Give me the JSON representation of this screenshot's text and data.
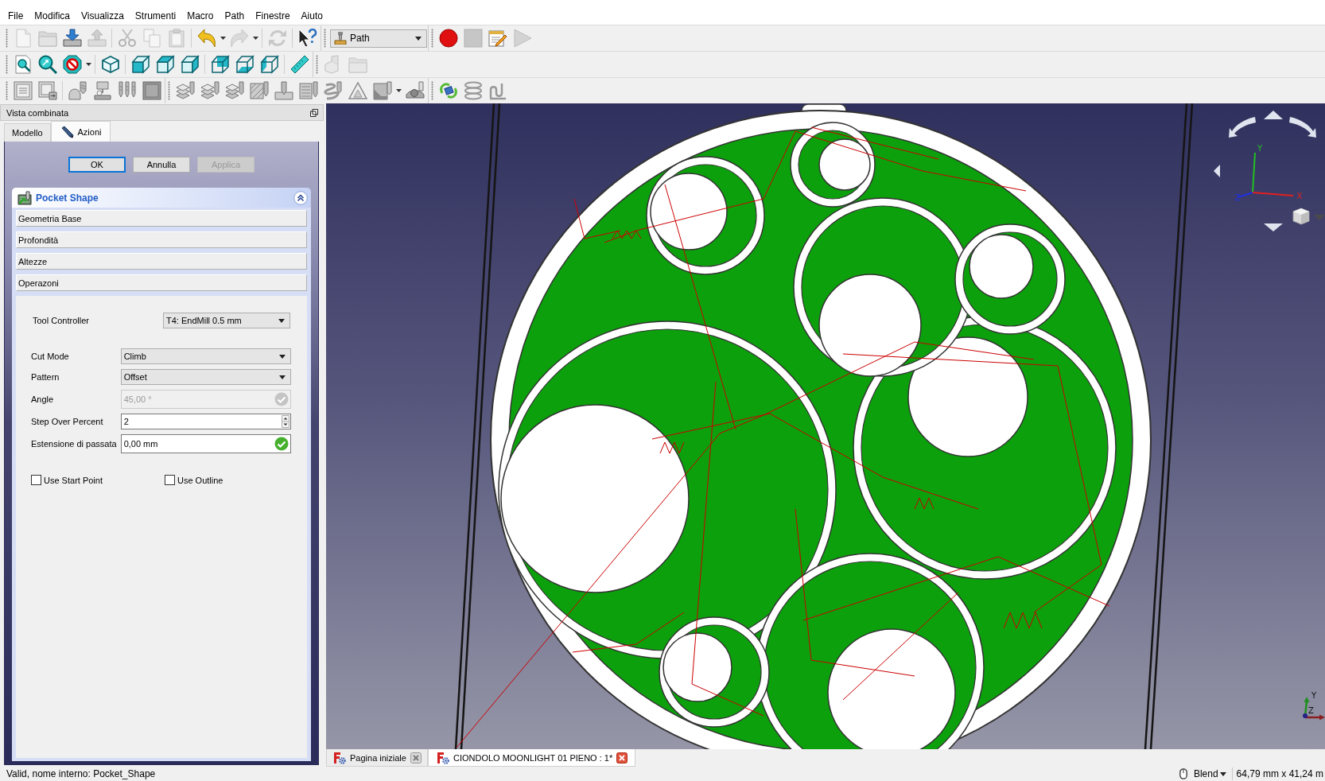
{
  "menu_bar": [
    "File",
    "Modifica",
    "Visualizza",
    "Strumenti",
    "Macro",
    "Path",
    "Finestre",
    "Aiuto"
  ],
  "toolbar_rows": [
    {
      "buttons": [
        {
          "disabled": true
        },
        {
          "disabled": true
        },
        {
          "disabled": false
        },
        {
          "disabled": true
        },
        {
          "disabled": true
        },
        {
          "disabled": true
        },
        {
          "disabled": true
        },
        {
          "disabled": false
        },
        {
          "disabled": true
        },
        {
          "disabled": true
        },
        {
          "disabled": false
        },
        {
          "disabled": false
        },
        {
          "disabled": true
        },
        {
          "disabled": false
        },
        {
          "disabled": true
        }
      ]
    },
    {
      "buttons": [
        {
          "disabled": false
        },
        {
          "disabled": false
        },
        {
          "disabled": false
        },
        {
          "disabled": false
        },
        {
          "disabled": false
        },
        {
          "disabled": false
        },
        {
          "disabled": false
        },
        {
          "disabled": false
        },
        {
          "disabled": false
        },
        {
          "disabled": false
        },
        {
          "disabled": false
        },
        {
          "disabled": true
        },
        {
          "disabled": true
        }
      ]
    },
    {
      "buttons": [
        {
          "disabled": false
        },
        {
          "disabled": false
        },
        {
          "disabled": false
        },
        {
          "disabled": false
        },
        {
          "disabled": false
        },
        {
          "disabled": false
        },
        {
          "disabled": false
        },
        {
          "disabled": false
        },
        {
          "disabled": false
        },
        {
          "disabled": false
        },
        {
          "disabled": false
        },
        {
          "disabled": false
        },
        {
          "disabled": false
        },
        {
          "disabled": false
        },
        {
          "disabled": false
        },
        {
          "disabled": false
        },
        {
          "disabled": false
        },
        {
          "disabled": false
        },
        {
          "disabled": false
        }
      ]
    }
  ],
  "workbench_selector": {
    "value": "Path"
  },
  "combo_view": {
    "title": "Vista combinata",
    "tabs": [
      {
        "label": "Modello",
        "selected": false
      },
      {
        "label": "Azioni",
        "selected": true
      }
    ]
  },
  "task_dialog": {
    "buttons": [
      {
        "label": "OK",
        "disabled": false,
        "focused": true
      },
      {
        "label": "Annulla",
        "disabled": false,
        "focused": false
      },
      {
        "label": "Applica",
        "disabled": true,
        "focused": false
      }
    ]
  },
  "task_panel": {
    "title": "Pocket Shape",
    "sections": [
      "Geometria Base",
      "Profondità",
      "Altezze",
      "Operazoni"
    ],
    "tool_controller": {
      "label": "Tool Controller",
      "value": "T4: EndMill 0.5 mm"
    },
    "fields": [
      {
        "kind": "dropdown",
        "label": "Cut Mode",
        "value": "Climb",
        "disabled": false
      },
      {
        "kind": "dropdown",
        "label": "Pattern",
        "value": "Offset",
        "disabled": false
      },
      {
        "kind": "quantity",
        "label": "Angle",
        "value": "45,00 °",
        "disabled": true
      },
      {
        "kind": "spinbox",
        "label": "Step Over Percent",
        "value": "2",
        "disabled": false
      },
      {
        "kind": "quantity",
        "label": "Estensione di passata",
        "value": "0,00 mm",
        "disabled": false
      }
    ],
    "checkboxes": [
      {
        "label": "Use Start Point",
        "checked": false
      },
      {
        "label": "Use Outline",
        "checked": false
      }
    ]
  },
  "viewport": {
    "nav_axis_labels": [
      "Y",
      "X",
      "Z"
    ],
    "corner_axis_labels": [
      "Y",
      "Z"
    ]
  },
  "document_tabs": [
    {
      "label": "Pagina iniziale",
      "selected": false
    },
    {
      "label": "CIONDOLO MOONLIGHT 01 PIENO : 1*",
      "selected": true
    }
  ],
  "status_bar": {
    "message": "Valid, nome interno: Pocket_Shape",
    "navigation_style": "Blend",
    "dimensions": "64,79 mm x 41,24 m"
  }
}
